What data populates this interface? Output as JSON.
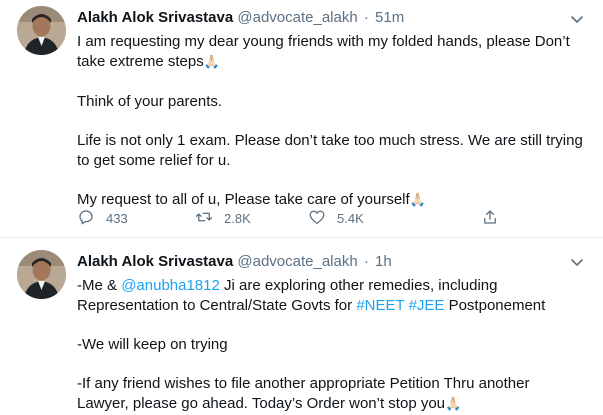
{
  "tweets": [
    {
      "author": "Alakh Alok Srivastava",
      "handle": "@advocate_alakh",
      "separator": "·",
      "time": "51m",
      "lines": [
        "I am requesting my dear young friends with my folded hands, please Don’t",
        "take extreme steps",
        "Think of your parents.",
        "Life is not only 1 exam. Please don’t take too much stress. We are still trying",
        "to get some relief for u.",
        "My request to all of u, Please take care of yourself"
      ],
      "emoji": "🙏🏻",
      "replies": "433",
      "retweets": "2.8K",
      "likes": "5.4K"
    },
    {
      "author": "Alakh Alok Srivastava",
      "handle": "@advocate_alakh",
      "separator": "·",
      "time": "1h",
      "line1_prefix": "-Me & ",
      "mention": "@anubha1812",
      "line1_suffix": " Ji are exploring other remedies, including",
      "line2_prefix": "Representation to Central/State Govts for ",
      "hashtag1": "#NEET",
      "hashtag2": "#JEE",
      "line2_suffix": " Postponement",
      "line3": "-We will keep on trying",
      "line4": "-If any friend wishes to file another appropriate Petition Thru another",
      "line5": "Lawyer, please go ahead. Today’s Order won’t stop you",
      "emoji": "🙏🏻"
    }
  ],
  "icons": {
    "caret": "chevron-down-icon",
    "reply": "reply-icon",
    "retweet": "retweet-icon",
    "like": "heart-icon",
    "share": "share-icon"
  },
  "colors": {
    "link": "#1da1f2",
    "muted": "#5b7083",
    "divider": "#e6ecf0"
  }
}
